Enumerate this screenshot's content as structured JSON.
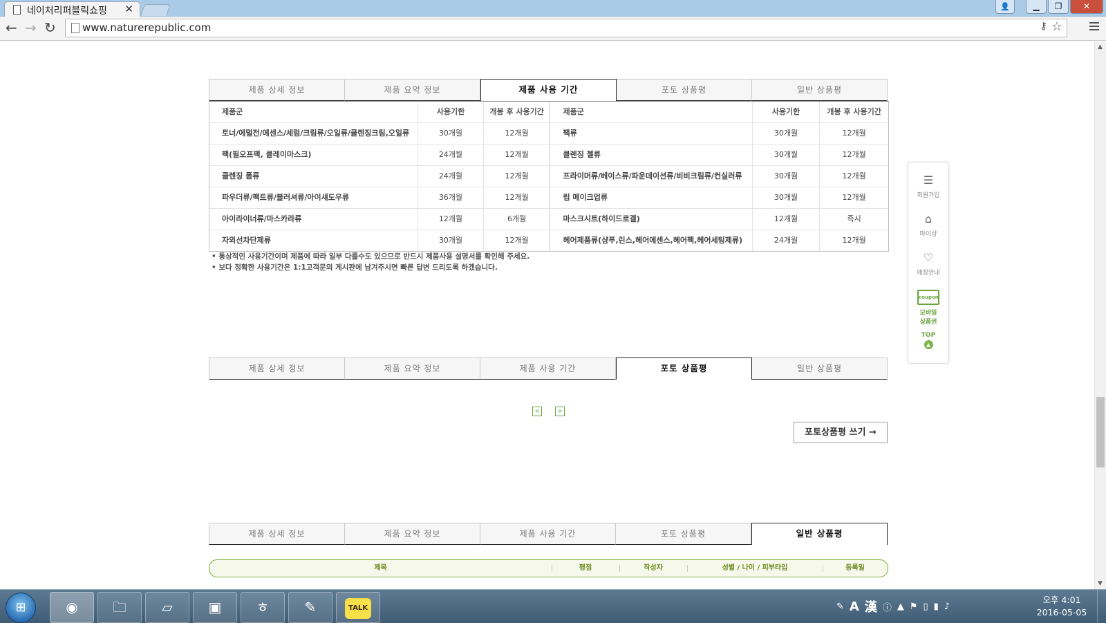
{
  "browser": {
    "tab_title": "네이처리퍼블릭쇼핑",
    "tab_close": "✕",
    "url": "www.naturerepublic.com"
  },
  "tabs": {
    "labels": [
      "제품 상세 정보",
      "제품 요약 정보",
      "제품 사용 기간",
      "포토 상품평",
      "일반 상품평"
    ]
  },
  "period_table": {
    "headers": {
      "group": "제품군",
      "expiry": "사용기한",
      "after_open": "개봉 후 사용기간"
    },
    "left_rows": [
      {
        "group": "토너/에멀전/에센스/세럼/크림류/오일류/클렌징크림,오일류",
        "expiry": "30개월",
        "after_open": "12개월"
      },
      {
        "group": "팩(필오프팩, 클레이마스크)",
        "expiry": "24개월",
        "after_open": "12개월"
      },
      {
        "group": "클렌징 폼류",
        "expiry": "24개월",
        "after_open": "12개월"
      },
      {
        "group": "파우더류/팩트류/블러셔류/아이섀도우류",
        "expiry": "36개월",
        "after_open": "12개월"
      },
      {
        "group": "아이라이너류/마스카라류",
        "expiry": "12개월",
        "after_open": "6개월"
      },
      {
        "group": "자외선차단제류",
        "expiry": "30개월",
        "after_open": "12개월"
      }
    ],
    "right_rows": [
      {
        "group": "팩류",
        "expiry": "30개월",
        "after_open": "12개월"
      },
      {
        "group": "클렌징 젤류",
        "expiry": "30개월",
        "after_open": "12개월"
      },
      {
        "group": "프라이머류/베이스류/파운데이션류/비비크림류/컨실러류",
        "expiry": "30개월",
        "after_open": "12개월"
      },
      {
        "group": "립 메이크업류",
        "expiry": "30개월",
        "after_open": "12개월"
      },
      {
        "group": "마스크시트(하이드로겔)",
        "expiry": "12개월",
        "after_open": "즉시"
      },
      {
        "group": "헤어제품류(샴푸,린스,헤어에센스,헤어팩,헤어세팅제류)",
        "expiry": "24개월",
        "after_open": "12개월"
      }
    ]
  },
  "notes": [
    "• 통상적인 사용기간이며 제품에 따라 일부 다를수도 있으므로 반드시 제품사용 설명서를 확인해 주세요.",
    "• 보다 정확한 사용기간은 1:1고객문의 게시판에 남겨주시면 빠른 답변 드리도록 하겠습니다."
  ],
  "photo_review": {
    "prev": "<",
    "next": ">",
    "write_button": "포토상품평 쓰기 →"
  },
  "review_table": {
    "headers": [
      "제목",
      "평점",
      "작성자",
      "성별 / 나이 / 피부타입",
      "등록일"
    ]
  },
  "quick_menu": {
    "items": [
      "회원가입",
      "마이샵",
      "매장안내",
      "모바일 상품권"
    ],
    "coupon_text": "coupon",
    "top": "TOP"
  },
  "taskbar": {
    "kakao": "TALK",
    "ime_a": "A",
    "ime_han": "漢",
    "time": "오후 4:01",
    "date": "2016-05-05"
  }
}
